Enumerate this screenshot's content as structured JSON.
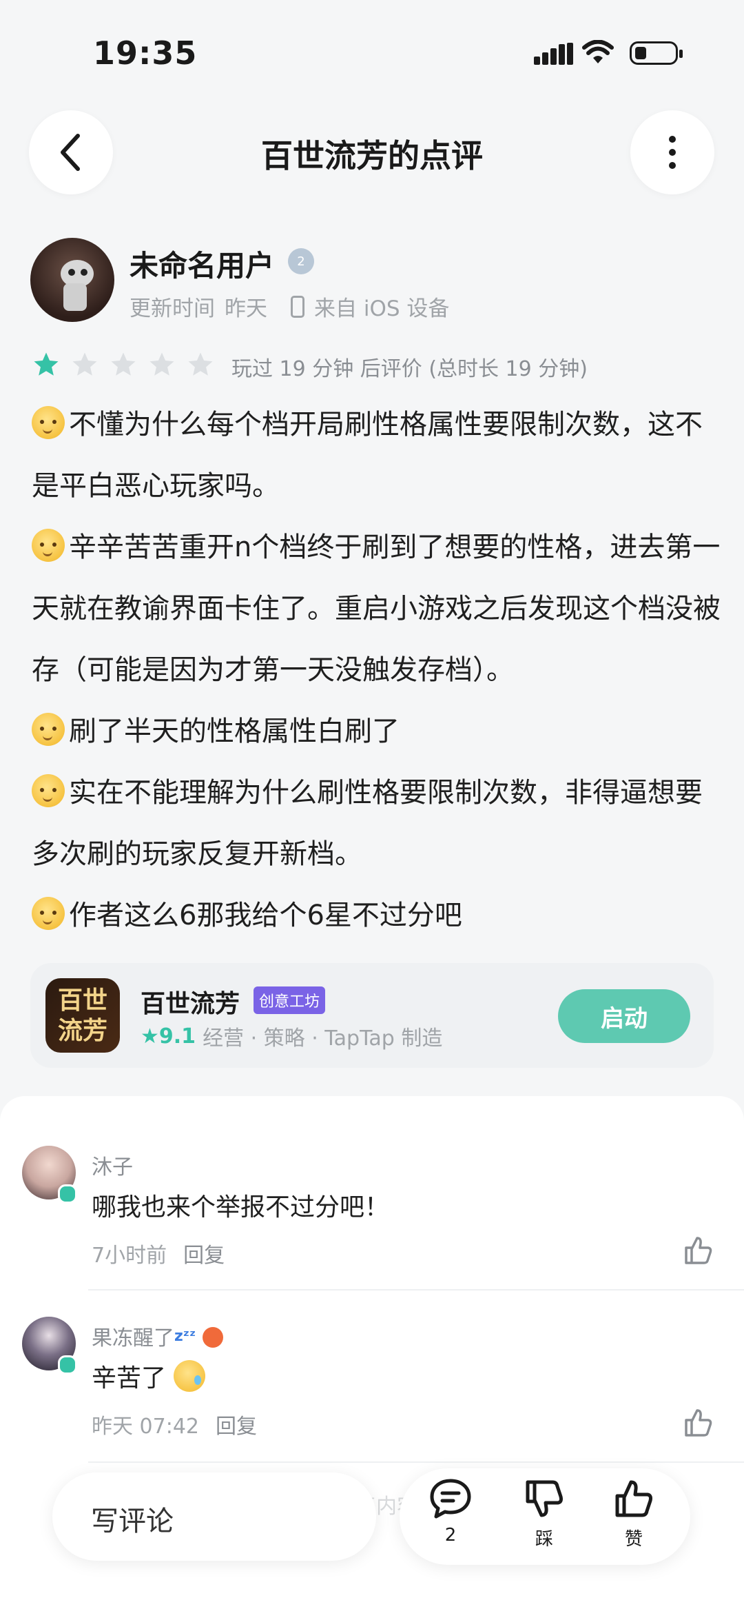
{
  "status": {
    "time": "19:35"
  },
  "header": {
    "title": "百世流芳的点评"
  },
  "review": {
    "user_name": "未命名用户",
    "level": "2",
    "updated_label": "更新时间",
    "updated": "昨天",
    "source": "来自 iOS 设备",
    "rating": 1,
    "rating_max": 5,
    "played": "玩过 19 分钟 后评价 (总时长 19 分钟)",
    "paragraphs": [
      "不懂为什么每个档开局刷性格属性要限制次数，这不是平白恶心玩家吗。",
      "辛辛苦苦重开n个档终于刷到了想要的性格，进去第一天就在教谕界面卡住了。重启小游戏之后发现这个档没被存（可能是因为才第一天没触发存档）。",
      "刷了半天的性格属性白刷了",
      "实在不能理解为什么刷性格要限制次数，非得逼想要多次刷的玩家反复开新档。",
      "作者这么6那我给个6星不过分吧"
    ]
  },
  "game": {
    "icon_text": "百世流芳",
    "name": "百世流芳",
    "tag": "创意工坊",
    "score": "9.1",
    "info": "经营 · 策略 · TapTap 制造",
    "launch": "启动"
  },
  "comments": [
    {
      "name": "沐子",
      "text": "哪我也来个举报不过分吧！",
      "time": "7小时前",
      "reply": "回复"
    },
    {
      "name": "果冻醒了",
      "text": "辛苦了",
      "time": "昨天 07:42",
      "reply": "回复"
    }
  ],
  "bottom": {
    "write": "写评论",
    "comment_count": "2",
    "dislike": "踩",
    "like": "赞",
    "faded": "更多回复内容"
  },
  "colors": {
    "accent": "#35c2a6",
    "launch": "#5ec9b1",
    "tag": "#7a63e6"
  }
}
